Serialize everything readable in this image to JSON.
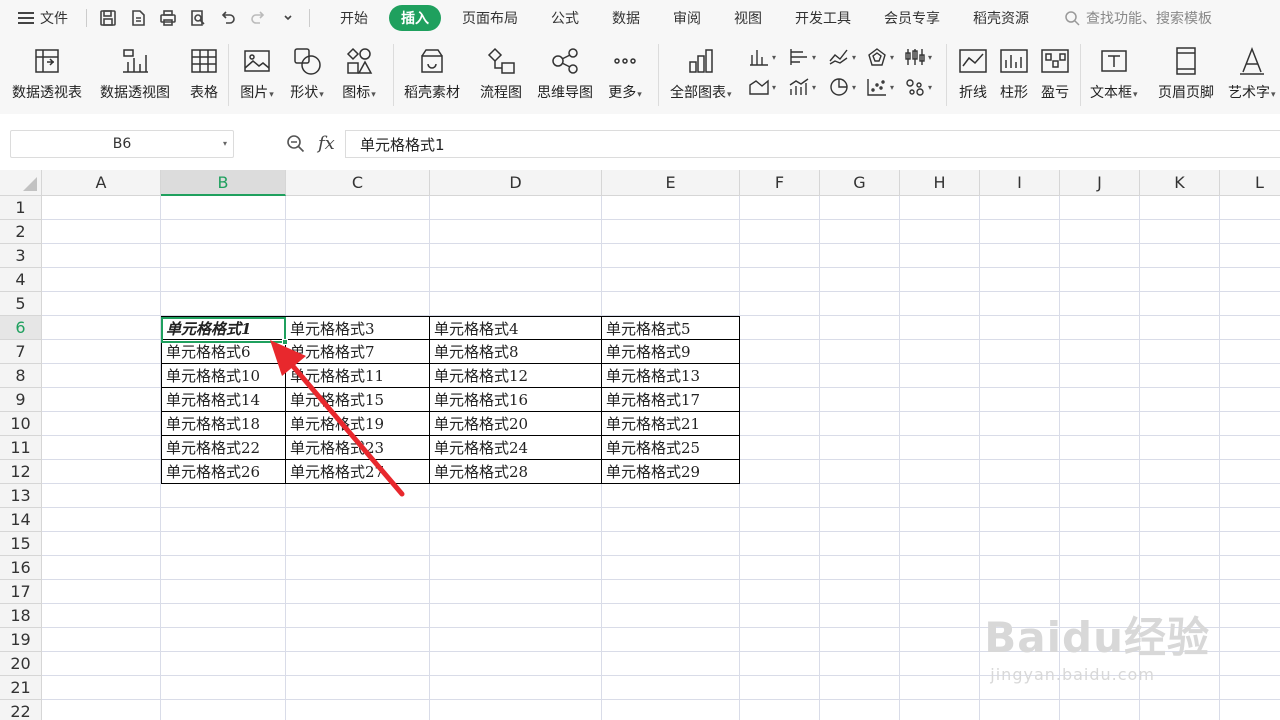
{
  "menu": {
    "file_label": "文件",
    "tabs": [
      "开始",
      "插入",
      "页面布局",
      "公式",
      "数据",
      "审阅",
      "视图",
      "开发工具",
      "会员专享",
      "稻壳资源"
    ],
    "active_tab": "插入",
    "search_placeholder": "查找功能、搜索模板"
  },
  "ribbon": {
    "pivot_table": "数据透视表",
    "pivot_chart": "数据透视图",
    "table": "表格",
    "picture": "图片",
    "shape": "形状",
    "icon": "图标",
    "docer_material": "稻壳素材",
    "flowchart": "流程图",
    "mindmap": "思维导图",
    "more": "更多",
    "all_charts": "全部图表",
    "line": "折线",
    "column": "柱形",
    "win_loss": "盈亏",
    "textbox": "文本框",
    "header_footer": "页眉页脚",
    "wordart": "艺术字"
  },
  "formula_bar": {
    "name_box": "B6",
    "fx": "fx",
    "content": "单元格格式1"
  },
  "sheet": {
    "columns": [
      "A",
      "B",
      "C",
      "D",
      "E",
      "F",
      "G",
      "H",
      "I",
      "J",
      "K",
      "L"
    ],
    "selected_column": "B",
    "rows": [
      "1",
      "2",
      "3",
      "4",
      "5",
      "6",
      "7",
      "8",
      "9",
      "10",
      "11",
      "12",
      "13",
      "14",
      "15",
      "16",
      "17",
      "18",
      "19",
      "20",
      "21",
      "22"
    ],
    "selected_row": "6",
    "active_cell": "B6",
    "table": [
      [
        "单元格格式1",
        "单元格格式3",
        "单元格格式4",
        "单元格格式5"
      ],
      [
        "单元格格式6",
        "单元格格式7",
        "单元格格式8",
        "单元格格式9"
      ],
      [
        "单元格格式10",
        "单元格格式11",
        "单元格格式12",
        "单元格格式13"
      ],
      [
        "单元格格式14",
        "单元格格式15",
        "单元格格式16",
        "单元格格式17"
      ],
      [
        "单元格格式18",
        "单元格格式19",
        "单元格格式20",
        "单元格格式21"
      ],
      [
        "单元格格式22",
        "单元格格式23",
        "单元格格式24",
        "单元格格式25"
      ],
      [
        "单元格格式26",
        "单元格格式27",
        "单元格格式28",
        "单元格格式29"
      ]
    ]
  },
  "watermark": {
    "brand": "Baidu经验",
    "url": "jingyan.baidu.com"
  },
  "colors": {
    "accent": "#1fa05e",
    "annotation_arrow": "#e8282d"
  }
}
